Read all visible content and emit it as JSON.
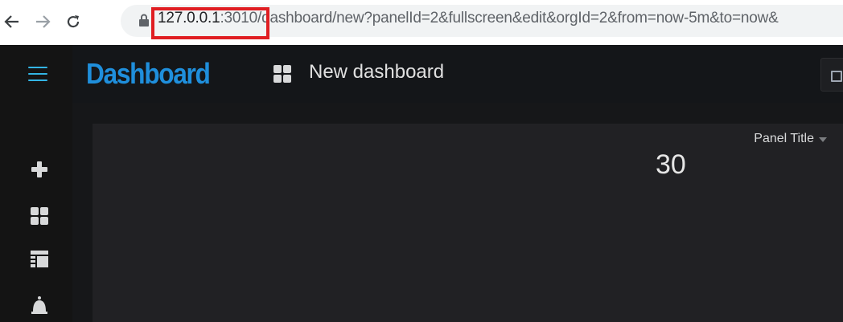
{
  "browser": {
    "url_host": "127.0.0.1",
    "url_port": ":3010/",
    "url_path": "dashboard/new?panelId=2&fullscreen&edit&orgId=2&from=now-5m&to=now&"
  },
  "app": {
    "brand": "Dashboard",
    "dashboard_title": "New dashboard"
  },
  "panel": {
    "title": "Panel Title",
    "value": "30"
  },
  "colors": {
    "accent": "#33b5e5",
    "brand": "#1f8fdc",
    "highlight": "#e01e22",
    "background": "#161719",
    "panel_bg": "#212124"
  },
  "icons": [
    "back-arrow-icon",
    "forward-arrow-icon",
    "reload-icon",
    "lock-icon",
    "hamburger-menu-icon",
    "dashboard-grid-icon",
    "save-icon",
    "plus-icon",
    "dashboards-icon",
    "explore-icon",
    "bell-icon",
    "caret-down-icon"
  ]
}
